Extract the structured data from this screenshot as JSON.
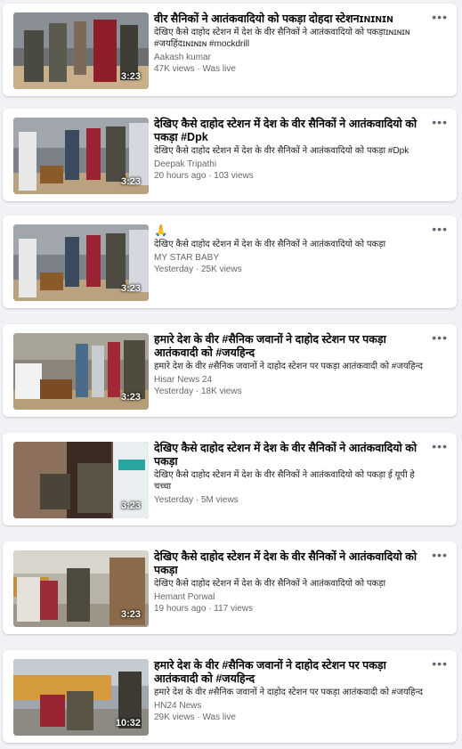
{
  "videos": [
    {
      "title": "वीर सैनिकों ने आतंकवादियो को पकड़ा दोहदा स्टेशनɪɴɪɴɪɴ",
      "desc": "देखिए कैसे दाहोद स्टेशन में देश के वीर सैनिकों ने आतंकवादियो को पकड़ाɪɴɪɴɪɴ #जयहिंदɪɴɪɴɪɴ #mockdrill",
      "channel": "Aakash kumar",
      "stats": "47K views · Was live",
      "duration": "3:23",
      "more_icon": "•••"
    },
    {
      "title": "देखिए कैसे दाहोद स्टेशन में देश के वीर सैनिकों ने आतंकवादियो को पकड़ा #Dpk",
      "desc": "देखिए कैसे दाहोद स्टेशन में देश के वीर सैनिकों ने आतंकवादियो को पकड़ा #Dpk",
      "channel": "Deepak Tripathi",
      "stats": "20 hours ago · 103 views",
      "duration": "3:23",
      "more_icon": "•••"
    },
    {
      "title": "🙏",
      "desc": "देखिए कैसे दाहोद स्टेशन में देश के वीर सैनिकों ने आतंकवादियो को पकड़ा",
      "channel": "MY STAR BABY",
      "stats": "Yesterday · 25K views",
      "duration": "3:23",
      "more_icon": "•••"
    },
    {
      "title": "हमारे देश के वीर #सैनिक जवानों ने दाहोद स्टेशन पर पकड़ा आतंकवादी को #जयहिन्द",
      "desc": "हमारे देश के वीर #सैनिक जवानों ने दाहोद स्टेशन पर पकड़ा आतंकवादी को #जयहिन्द",
      "channel": "Hisar News 24",
      "stats": "Yesterday · 18K views",
      "duration": "3:23",
      "more_icon": "•••"
    },
    {
      "title": "देखिए कैसे दाहोद स्टेशन में देश के वीर सैनिकों ने आतंकवादियो को पकड़ा",
      "desc": "देखिए कैसे दाहोद स्टेशन में देश के वीर सैनिकों ने आतंकवादियो को पकड़ा ई यूपी हे चच्चा",
      "channel": "",
      "stats": "Yesterday · 5M views",
      "duration": "3:23",
      "more_icon": "•••"
    },
    {
      "title": "देखिए कैसे दाहोद स्टेशन में देश के वीर सैनिकों ने आतंकवादियो को पकड़ा",
      "desc": "देखिए कैसे दाहोद स्टेशन में देश के वीर सैनिकों ने आतंकवादियो को पकड़ा",
      "channel": "Hemant Porwal",
      "stats": "19 hours ago · 117 views",
      "duration": "3:23",
      "more_icon": "•••"
    },
    {
      "title": "हमारे देश के वीर #सैनिक जवानों ने दाहोद स्टेशन पर पकड़ा आतंकवादी को #जयहिन्द",
      "desc": "हमारे देश के वीर #सैनिक जवानों ने दाहोद स्टेशन पर पकड़ा आतंकवादी को #जयहिन्द",
      "channel": "HN24 News",
      "stats": "29K views · Was live",
      "duration": "10:32",
      "more_icon": "•••"
    }
  ]
}
